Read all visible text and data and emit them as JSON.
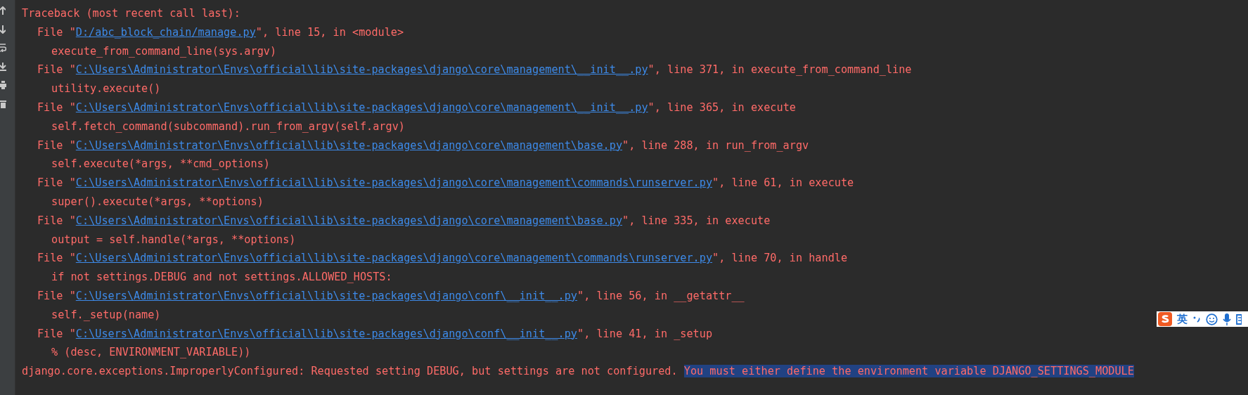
{
  "console_lines": [
    {
      "kind": "header",
      "text": "Traceback (most recent call last):"
    },
    {
      "kind": "frame",
      "before": "File \"",
      "path": "D:/abc_block_chain/manage.py",
      "after": "\", line 15, in <module>"
    },
    {
      "kind": "code",
      "text": "execute_from_command_line(sys.argv)"
    },
    {
      "kind": "frame",
      "before": "File \"",
      "path": "C:\\Users\\Administrator\\Envs\\official\\lib\\site-packages\\django\\core\\management\\__init__.py",
      "after": "\", line 371, in execute_from_command_line"
    },
    {
      "kind": "code",
      "text": "utility.execute()"
    },
    {
      "kind": "frame",
      "before": "File \"",
      "path": "C:\\Users\\Administrator\\Envs\\official\\lib\\site-packages\\django\\core\\management\\__init__.py",
      "after": "\", line 365, in execute"
    },
    {
      "kind": "code",
      "text": "self.fetch_command(subcommand).run_from_argv(self.argv)"
    },
    {
      "kind": "frame",
      "before": "File \"",
      "path": "C:\\Users\\Administrator\\Envs\\official\\lib\\site-packages\\django\\core\\management\\base.py",
      "after": "\", line 288, in run_from_argv"
    },
    {
      "kind": "code",
      "text": "self.execute(*args, **cmd_options)"
    },
    {
      "kind": "frame",
      "before": "File \"",
      "path": "C:\\Users\\Administrator\\Envs\\official\\lib\\site-packages\\django\\core\\management\\commands\\runserver.py",
      "after": "\", line 61, in execute"
    },
    {
      "kind": "code",
      "text": "super().execute(*args, **options)"
    },
    {
      "kind": "frame",
      "before": "File \"",
      "path": "C:\\Users\\Administrator\\Envs\\official\\lib\\site-packages\\django\\core\\management\\base.py",
      "after": "\", line 335, in execute"
    },
    {
      "kind": "code",
      "text": "output = self.handle(*args, **options)"
    },
    {
      "kind": "frame",
      "before": "File \"",
      "path": "C:\\Users\\Administrator\\Envs\\official\\lib\\site-packages\\django\\core\\management\\commands\\runserver.py",
      "after": "\", line 70, in handle"
    },
    {
      "kind": "code",
      "text": "if not settings.DEBUG and not settings.ALLOWED_HOSTS:"
    },
    {
      "kind": "frame",
      "before": "File \"",
      "path": "C:\\Users\\Administrator\\Envs\\official\\lib\\site-packages\\django\\conf\\__init__.py",
      "after": "\", line 56, in __getattr__"
    },
    {
      "kind": "code",
      "text": "self._setup(name)"
    },
    {
      "kind": "frame",
      "before": "File \"",
      "path": "C:\\Users\\Administrator\\Envs\\official\\lib\\site-packages\\django\\conf\\__init__.py",
      "after": "\", line 41, in _setup"
    },
    {
      "kind": "code",
      "text": "% (desc, ENVIRONMENT_VARIABLE))"
    },
    {
      "kind": "error",
      "text": "django.core.exceptions.ImproperlyConfigured: Requested setting DEBUG, but settings are not configured. ",
      "selected_text": "You must either define the environment variable DJANGO_SETTINGS_MODULE"
    }
  ],
  "ime_toolbar": {
    "language": "英"
  }
}
